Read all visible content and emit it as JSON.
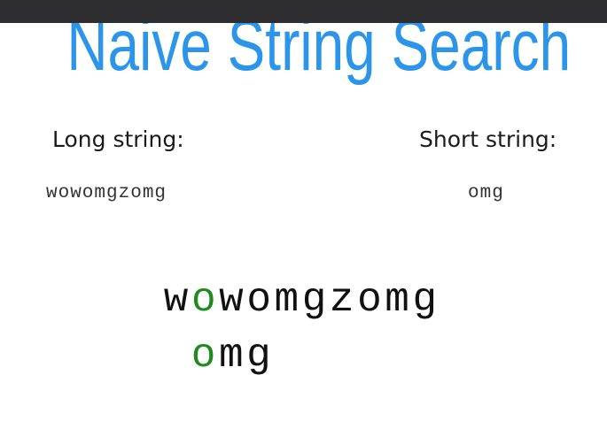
{
  "title": "Naive String Search",
  "long": {
    "label": "Long string:",
    "value": "wowomgzomg"
  },
  "short": {
    "label": "Short string:",
    "value": "omg"
  },
  "visualization": {
    "haystack": [
      "w",
      "o",
      "w",
      "o",
      "m",
      "g",
      "z",
      "o",
      "m",
      "g"
    ],
    "needle": [
      "o",
      "m",
      "g"
    ],
    "match_index_haystack": 1,
    "match_index_needle": 0,
    "match_color": "#1f8b1f",
    "text_color": "#111111"
  },
  "colors": {
    "title": "#2c95ea",
    "topbar": "#2e2e31"
  }
}
